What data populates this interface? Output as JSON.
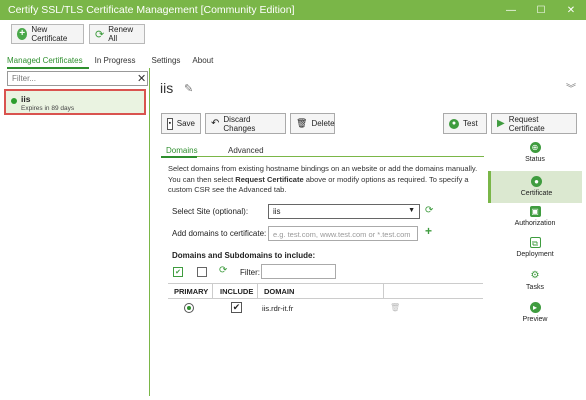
{
  "window": {
    "title": "Certify SSL/TLS Certificate Management [Community Edition]",
    "minimize": "—",
    "maximize": "☐",
    "close": "✕"
  },
  "toolbar": {
    "new_certificate": "New Certificate",
    "renew_all": "Renew All"
  },
  "main_tabs": [
    "Managed Certificates",
    "In Progress",
    "Settings",
    "About"
  ],
  "left": {
    "filter_placeholder": "Filter...",
    "items": [
      {
        "name": "iis",
        "expiry": "Expires in 89 days"
      }
    ]
  },
  "detail": {
    "site_title": "iis",
    "actions": {
      "save": "Save",
      "discard": "Discard Changes",
      "delete": "Delete",
      "test": "Test",
      "request": "Request Certificate"
    },
    "subtabs": [
      "Domains",
      "Advanced"
    ],
    "description_part1": "Select domains from existing hostname bindings on an website or add the domains manually. You can then select ",
    "description_bold": "Request Certificate",
    "description_part2": " above or modify options as required. To specify a custom CSR see the Advanced tab.",
    "select_site_label": "Select Site (optional):",
    "select_site_value": "iis",
    "add_domains_label": "Add domains to certificate:",
    "add_domains_placeholder": "e.g. test.com, www.test.com or *.test.com",
    "domains_section_title": "Domains and Subdomains to include:",
    "filter_label": "Filter:",
    "columns": [
      "PRIMARY",
      "INCLUDE",
      "DOMAIN"
    ],
    "rows": [
      {
        "primary": true,
        "include": true,
        "domain": "iis.rdr-it.fr"
      }
    ]
  },
  "sidenav": [
    {
      "label": "Status",
      "icon": "status-icon",
      "active": false
    },
    {
      "label": "Certificate",
      "icon": "certificate-icon",
      "active": true
    },
    {
      "label": "Authorization",
      "icon": "lock-icon",
      "active": false
    },
    {
      "label": "Deployment",
      "icon": "deployment-icon",
      "active": false
    },
    {
      "label": "Tasks",
      "icon": "tasks-icon",
      "active": false
    },
    {
      "label": "Preview",
      "icon": "preview-icon",
      "active": false
    }
  ],
  "colors": {
    "accent": "#7ab648",
    "accent_dark": "#2e8f2e",
    "selection_border": "#d9534f"
  }
}
